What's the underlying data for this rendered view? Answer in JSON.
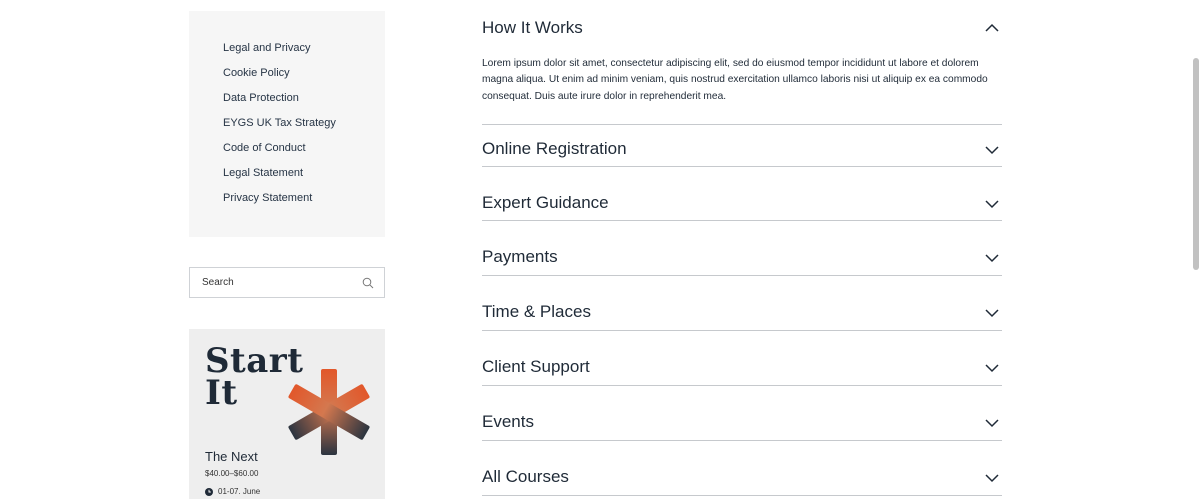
{
  "sidebar": {
    "links": [
      "Legal and Privacy",
      "Cookie Policy",
      "Data Protection",
      "EYGS UK Tax Strategy",
      "Code of Conduct",
      "Legal Statement",
      "Privacy Statement"
    ]
  },
  "search": {
    "placeholder": "Search"
  },
  "promo": {
    "headline_line1": "Start",
    "headline_line2": "It",
    "title": "The Next",
    "price": "$40.00–$60.00",
    "date": "01-07. June"
  },
  "accordion": {
    "items": [
      {
        "title": "How It Works",
        "expanded": true,
        "body": "Lorem ipsum dolor sit amet, consectetur adipiscing elit, sed do eiusmod tempor incididunt ut labore et dolorem magna aliqua. Ut enim ad minim veniam, quis nostrud exercitation ullamco laboris nisi ut aliquip ex ea commodo consequat. Duis aute irure dolor in reprehenderit mea."
      },
      {
        "title": "Online Registration",
        "expanded": false
      },
      {
        "title": "Expert Guidance",
        "expanded": false
      },
      {
        "title": "Payments",
        "expanded": false
      },
      {
        "title": "Time & Places",
        "expanded": false
      },
      {
        "title": "Client Support",
        "expanded": false
      },
      {
        "title": "Events",
        "expanded": false
      },
      {
        "title": "All Courses",
        "expanded": false
      }
    ]
  },
  "colors": {
    "text": "#1f2a37",
    "accent": "#e2572a",
    "divider": "#c6c9cd"
  }
}
